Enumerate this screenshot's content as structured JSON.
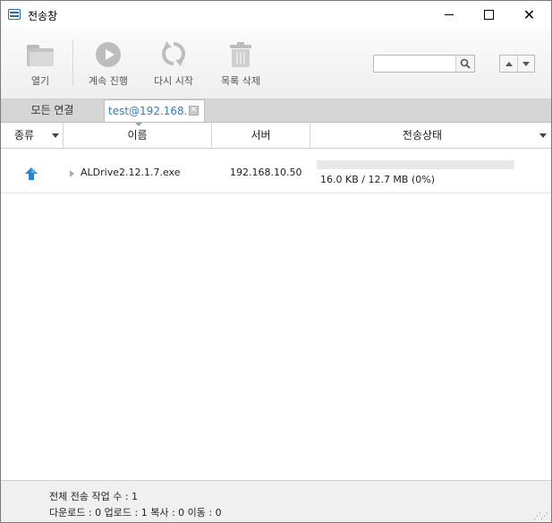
{
  "window": {
    "title": "전송창",
    "controls": {
      "minimize_icon": "minimize-icon",
      "maximize_icon": "maximize-icon",
      "close_icon": "close-icon"
    }
  },
  "toolbar": {
    "open_label": "열기",
    "resume_label": "계속 진행",
    "restart_label": "다시 시작",
    "delete_label": "목록 삭제",
    "search": {
      "value": "",
      "placeholder": ""
    }
  },
  "tabs": [
    {
      "label": "모든 연결",
      "active": false
    },
    {
      "label": "test@192.168....",
      "active": true
    }
  ],
  "columns": {
    "type": "종류",
    "name": "이름",
    "server": "서버",
    "status": "전송상태"
  },
  "transfers": [
    {
      "direction": "upload",
      "icon": "upload-arrow-icon",
      "name": "ALDrive2.12.1.7.exe",
      "server": "192.168.10.50",
      "progress_percent": 0,
      "progress_text": "16.0 KB / 12.7 MB (0%)"
    }
  ],
  "status": {
    "total_label": "전체 전송 작업 수 : 1",
    "breakdown_label": "다운로드 : 0  업로드 : 1  복사 : 0  이동 : 0"
  },
  "colors": {
    "accent": "#2f7ec4",
    "upload_arrow": "#1e88d6",
    "icon_gray": "#bdbdbd"
  }
}
